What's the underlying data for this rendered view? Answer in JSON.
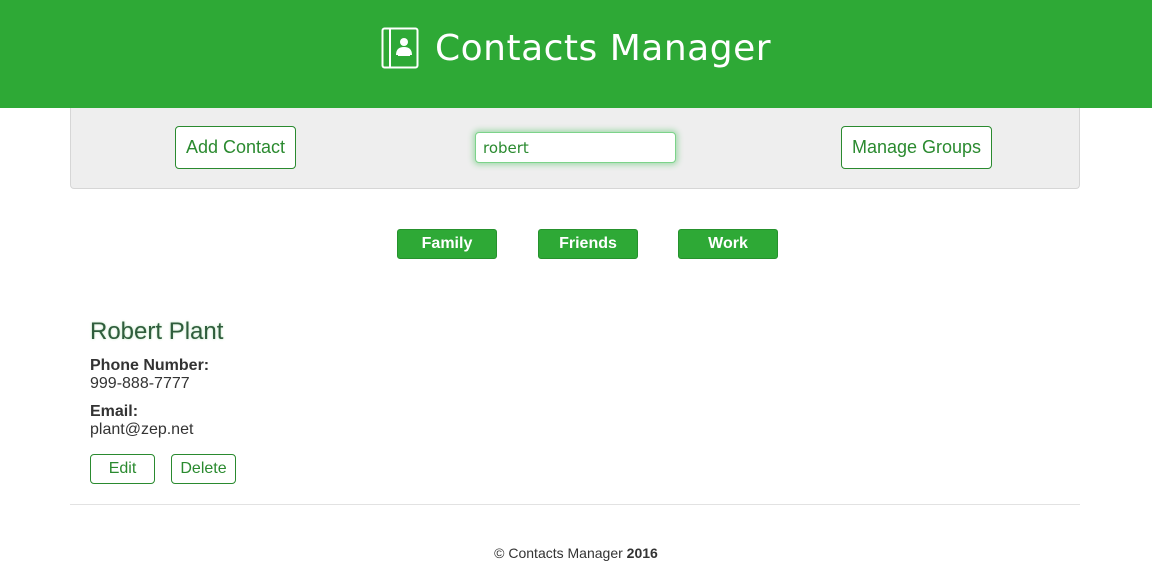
{
  "header": {
    "title": "Contacts Manager",
    "icon": "address-book-icon",
    "background_color": "#2ea936"
  },
  "toolbar": {
    "add_contact_label": "Add Contact",
    "search_value": "robert",
    "manage_groups_label": "Manage Groups"
  },
  "groups": [
    {
      "label": "Family"
    },
    {
      "label": "Friends"
    },
    {
      "label": "Work"
    }
  ],
  "contact": {
    "name": "Robert Plant",
    "phone_label": "Phone Number:",
    "phone": "999-888-7777",
    "email_label": "Email:",
    "email": "plant@zep.net",
    "edit_label": "Edit",
    "delete_label": "Delete"
  },
  "footer": {
    "prefix": "© Contacts Manager",
    "year": "2016"
  },
  "colors": {
    "accent": "#2ea936",
    "accent_text": "#2a8a2f"
  }
}
